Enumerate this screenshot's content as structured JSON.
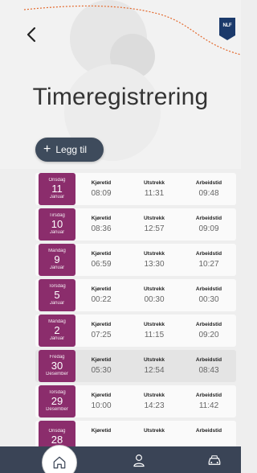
{
  "header": {
    "title": "Timeregistrering",
    "logo_text": "NLF"
  },
  "add_button": {
    "label": "Legg til"
  },
  "column_labels": {
    "kjoretid": "Kjøretid",
    "utstrekk": "Utstrekk",
    "arbeidstid": "Arbeidstid"
  },
  "entries": [
    {
      "weekday": "Onsdag",
      "day": "11",
      "month": "Januar",
      "kjoretid": "08:09",
      "utstrekk": "11:31",
      "arbeidstid": "09:48"
    },
    {
      "weekday": "Tirsdag",
      "day": "10",
      "month": "Januar",
      "kjoretid": "08:36",
      "utstrekk": "12:57",
      "arbeidstid": "09:09"
    },
    {
      "weekday": "Mandag",
      "day": "9",
      "month": "Januar",
      "kjoretid": "06:59",
      "utstrekk": "13:30",
      "arbeidstid": "10:27"
    },
    {
      "weekday": "Torsdag",
      "day": "5",
      "month": "Januar",
      "kjoretid": "00:22",
      "utstrekk": "00:30",
      "arbeidstid": "00:30"
    },
    {
      "weekday": "Mandag",
      "day": "2",
      "month": "Januar",
      "kjoretid": "07:25",
      "utstrekk": "11:15",
      "arbeidstid": "09:20"
    },
    {
      "weekday": "Fredag",
      "day": "30",
      "month": "Desember",
      "kjoretid": "05:30",
      "utstrekk": "12:54",
      "arbeidstid": "08:43"
    },
    {
      "weekday": "Torsdag",
      "day": "29",
      "month": "Desember",
      "kjoretid": "10:00",
      "utstrekk": "14:23",
      "arbeidstid": "11:42"
    },
    {
      "weekday": "Onsdag",
      "day": "28",
      "month": "",
      "kjoretid": "",
      "utstrekk": "",
      "arbeidstid": ""
    }
  ],
  "nav": {
    "items": [
      "home-icon",
      "user-icon",
      "car-icon"
    ],
    "active": "home-icon"
  },
  "colors": {
    "date_accent": "#8b2d6c",
    "nav_background": "#3a4456",
    "button_background": "#3e4b5c",
    "decoration_line": "#e36a2e"
  }
}
